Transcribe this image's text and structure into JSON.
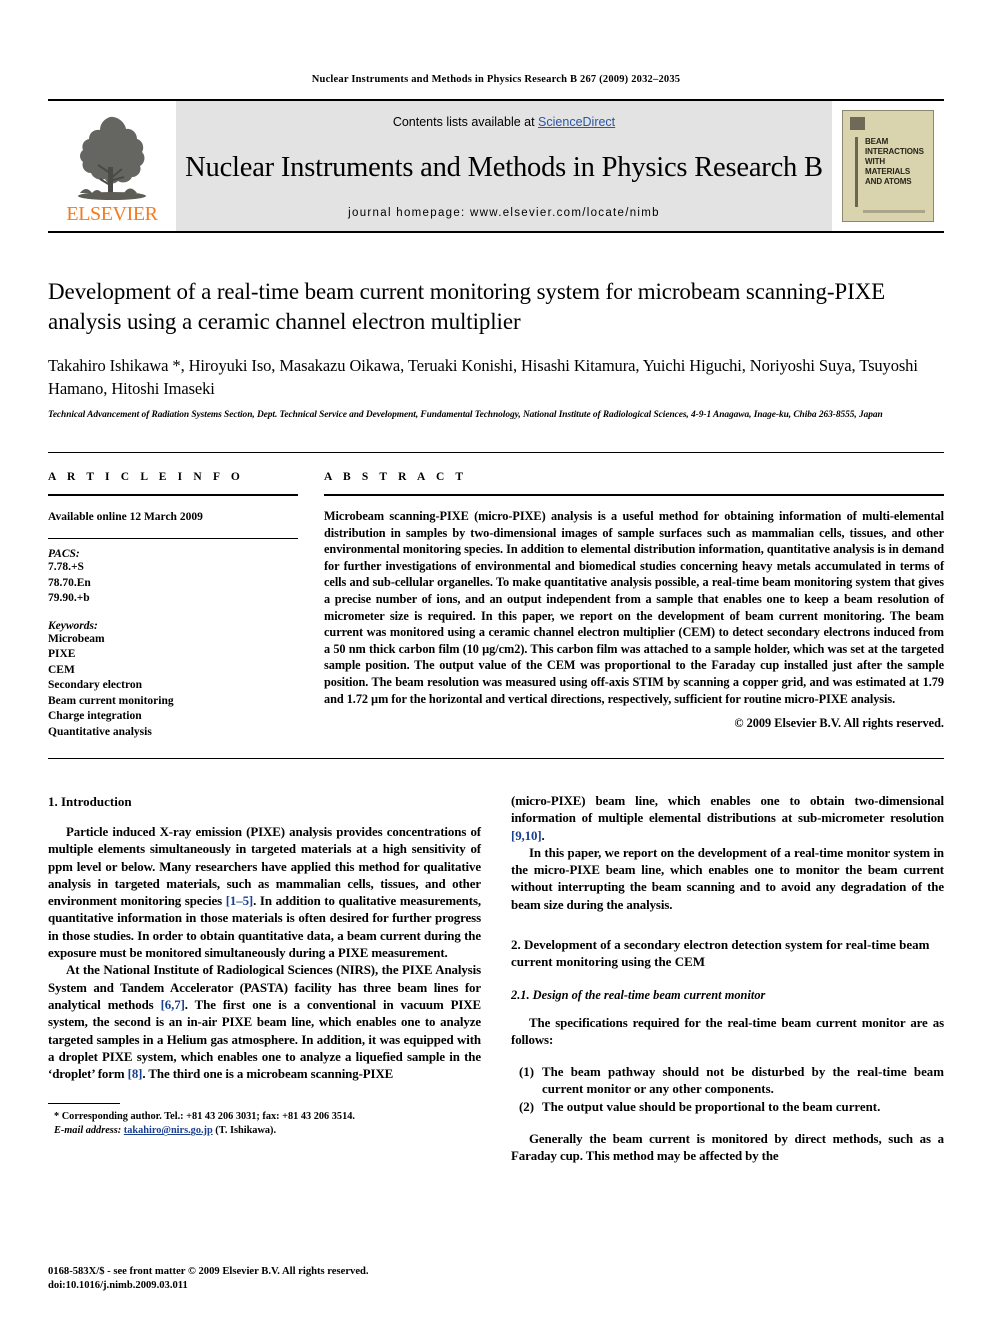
{
  "running_head": "Nuclear Instruments and Methods in Physics Research B 267 (2009) 2032–2035",
  "masthead": {
    "publisher_name": "ELSEVIER",
    "contents_prefix": "Contents lists available at ",
    "contents_link": "ScienceDirect",
    "journal_title": "Nuclear Instruments and Methods in Physics Research B",
    "homepage": "journal homepage: www.elsevier.com/locate/nimb",
    "cover_lines": [
      "BEAM",
      "INTERACTIONS",
      "WITH",
      "MATERIALS",
      "AND ATOMS"
    ]
  },
  "article": {
    "title": "Development of a real-time beam current monitoring system for microbeam scanning-PIXE analysis using a ceramic channel electron multiplier",
    "authors": "Takahiro Ishikawa *, Hiroyuki Iso, Masakazu Oikawa, Teruaki Konishi, Hisashi Kitamura, Yuichi Higuchi, Noriyoshi Suya, Tsuyoshi Hamano, Hitoshi Imaseki",
    "affiliation": "Technical Advancement of Radiation Systems Section, Dept. Technical Service and Development, Fundamental Technology, National Institute of Radiological Sciences, 4-9-1 Anagawa, Inage-ku, Chiba 263-8555, Japan"
  },
  "article_info": {
    "heading": "A R T I C L E  I N F O",
    "history": "Available online 12 March 2009",
    "pacs_label": "PACS:",
    "pacs": [
      "7.78.+S",
      "78.70.En",
      "79.90.+b"
    ],
    "keywords_label": "Keywords:",
    "keywords": [
      "Microbeam",
      "PIXE",
      "CEM",
      "Secondary electron",
      "Beam current monitoring",
      "Charge integration",
      "Quantitative analysis"
    ]
  },
  "abstract": {
    "heading": "A B S T R A C T",
    "text": "Microbeam scanning-PIXE (micro-PIXE) analysis is a useful method for obtaining information of multi-elemental distribution in samples by two-dimensional images of sample surfaces such as mammalian cells, tissues, and other environmental monitoring species. In addition to elemental distribution information, quantitative analysis is in demand for further investigations of environmental and biomedical studies concerning heavy metals accumulated in terms of cells and sub-cellular organelles. To make quantitative analysis possible, a real-time beam monitoring system that gives a precise number of ions, and an output independent from a sample that enables one to keep a beam resolution of micrometer size is required. In this paper, we report on the development of beam current monitoring. The beam current was monitored using a ceramic channel electron multiplier (CEM) to detect secondary electrons induced from a 50 nm thick carbon film (10 µg/cm2). This carbon film was attached to a sample holder, which was set at the targeted sample position. The output value of the CEM was proportional to the Faraday cup installed just after the sample position. The beam resolution was measured using off-axis STIM by scanning a copper grid, and was estimated at 1.79 and 1.72 µm for the horizontal and vertical directions, respectively, sufficient for routine micro-PIXE analysis.",
    "copyright": "© 2009 Elsevier B.V. All rights reserved."
  },
  "sections": {
    "intro_heading": "1. Introduction",
    "intro_p1_a": "Particle induced X-ray emission (PIXE) analysis provides concentrations of multiple elements simultaneously in targeted materials at a high sensitivity of ppm level or below. Many researchers have applied this method for qualitative analysis in targeted materials, such as mammalian cells, tissues, and other environment monitoring species ",
    "intro_p1_ref": "[1–5]",
    "intro_p1_b": ". In addition to qualitative measurements, quantitative information in those materials is often desired for further progress in those studies. In order to obtain quantitative data, a beam current during the exposure must be monitored simultaneously during a PIXE measurement.",
    "intro_p2_a": "At the National Institute of Radiological Sciences (NIRS), the PIXE Analysis System and Tandem Accelerator (PASTA) facility has three beam lines for analytical methods ",
    "intro_p2_ref1": "[6,7]",
    "intro_p2_b": ". The first one is a conventional in vacuum PIXE system, the second is an in-air PIXE beam line, which enables one to analyze targeted samples in a Helium gas atmosphere. In addition, it was equipped with a droplet PIXE system, which enables one to analyze a liquefied sample in the ‘droplet’ form ",
    "intro_p2_ref2": "[8]",
    "intro_p2_c": ". The third one is a microbeam scanning-PIXE",
    "right_p1_a": "(micro-PIXE) beam line, which enables one to obtain two-dimensional information of multiple elemental distributions at sub-micrometer resolution ",
    "right_p1_ref": "[9,10]",
    "right_p1_b": ".",
    "right_p2": "In this paper, we report on the development of a real-time monitor system in the micro-PIXE beam line, which enables one to monitor the beam current without interrupting the beam scanning and to avoid any degradation of the beam size during the analysis.",
    "sec2_heading": "2. Development of a secondary electron detection system for real-time beam current monitoring using the CEM",
    "sec21_heading": "2.1.  Design of the real-time beam current monitor",
    "sec21_p1": "The specifications required for the real-time beam current monitor are as follows:",
    "spec_items": [
      {
        "num": "(1)",
        "text": "The beam pathway should not be disturbed by the real-time beam current monitor or any other components."
      },
      {
        "num": "(2)",
        "text": "The output value should be proportional to the beam current."
      }
    ],
    "sec21_p2": "Generally the beam current is monitored by direct methods, such as a Faraday cup. This method may be affected by the"
  },
  "footnote": {
    "marker": "*",
    "line1": "Corresponding author. Tel.: +81 43 206 3031; fax: +81 43 206 3514.",
    "email_label": "E-mail address:",
    "email": "takahiro@nirs.go.jp",
    "email_suffix": "(T. Ishikawa)."
  },
  "page_footer": {
    "line1": "0168-583X/$ - see front matter © 2009 Elsevier B.V. All rights reserved.",
    "line2": "doi:10.1016/j.nimb.2009.03.011"
  },
  "colors": {
    "link": "#2a56a5",
    "reference": "#1a3f8f",
    "elsevier_orange": "#F47B20",
    "masthead_bg": "#e3e3e3",
    "cover_bg": "#d9d3ae"
  }
}
